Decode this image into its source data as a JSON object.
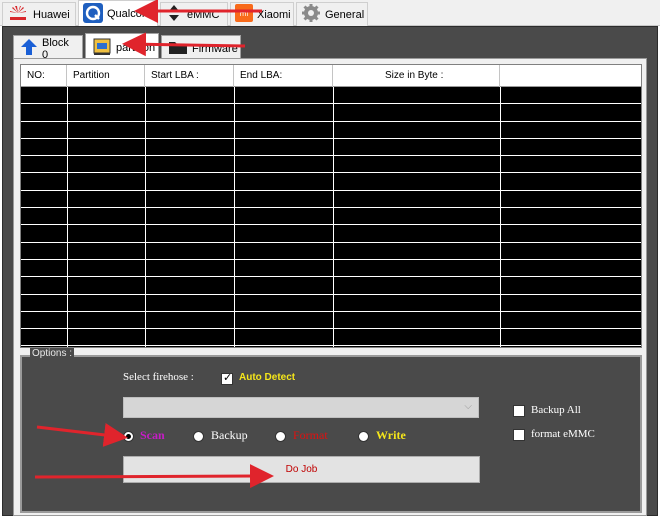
{
  "top_tabs": [
    {
      "label": "Huawei",
      "icon": "huawei-logo-icon"
    },
    {
      "label": "Qualcom",
      "icon": "qualcomm-icon",
      "active": true
    },
    {
      "label": "eMMC",
      "icon": "emmc-chip-icon"
    },
    {
      "label": "Xiaomi",
      "icon": "xiaomi-logo-icon"
    },
    {
      "label": "General",
      "icon": "gear-icon"
    }
  ],
  "sub_tabs": [
    {
      "label": "Block 0",
      "icon": "upload-arrow-icon"
    },
    {
      "label": "partition",
      "icon": "partition-icon",
      "active": true
    },
    {
      "label": "Firmware",
      "icon": "folder-icon"
    }
  ],
  "table": {
    "columns": [
      "NO:",
      "Partition",
      "Start LBA :",
      "End LBA:",
      "Size in Byte :",
      ""
    ]
  },
  "options": {
    "title": "Options :",
    "select_firehose_label": "Select firehose :",
    "auto_detect_label": "Auto Detect",
    "auto_detect_checked": true,
    "firehose_value": "",
    "modes": [
      {
        "label": "Scan",
        "color": "#c61cc6",
        "selected": true
      },
      {
        "label": "Backup",
        "color": "#ffffff",
        "selected": false
      },
      {
        "label": "Format",
        "color": "#e01010",
        "selected": false
      },
      {
        "label": "Write",
        "color": "#f5e61a",
        "selected": false
      }
    ],
    "backup_all_label": "Backup All",
    "backup_all_checked": false,
    "format_emmc_label": "format eMMC",
    "format_emmc_checked": false,
    "do_job_label": "Do Job"
  },
  "colors": {
    "annotation_arrow": "#e0242c",
    "auto_detect_text": "#f5e61a"
  }
}
